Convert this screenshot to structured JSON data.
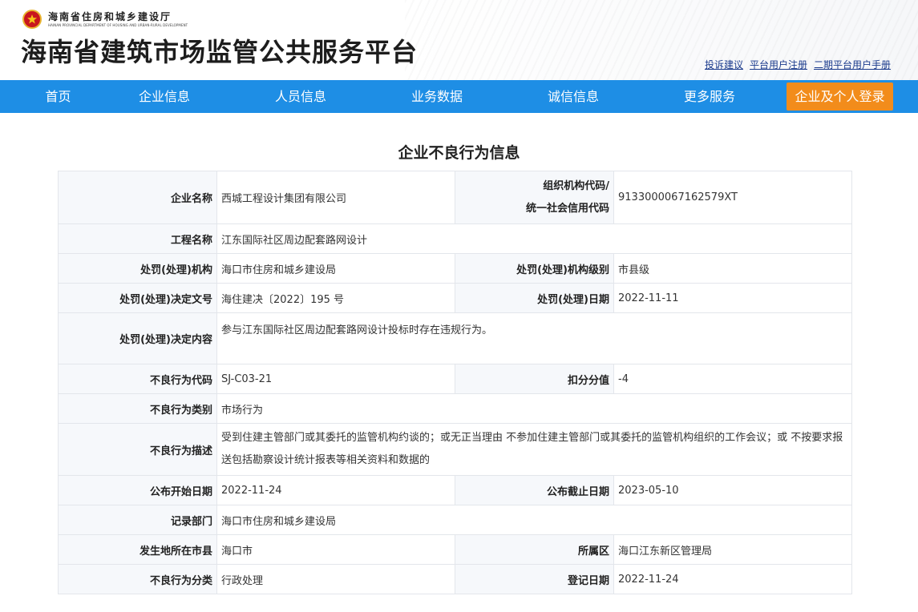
{
  "header": {
    "dept_name_cn": "海南省住房和城乡建设厅",
    "dept_name_en": "HAINAN PROVINCIAL DEPARTMENT OF HOUSING AND URBAN-RURAL DEVELOPMENT",
    "platform_title": "海南省建筑市场监管公共服务平台",
    "links": [
      "投诉建议",
      "平台用户注册",
      "二期平台用户手册"
    ]
  },
  "nav": {
    "items": [
      "首页",
      "企业信息",
      "人员信息",
      "业务数据",
      "诚信信息",
      "更多服务"
    ],
    "login": "企业及个人登录"
  },
  "page": {
    "title": "企业不良行为信息"
  },
  "record": {
    "company_name_label": "企业名称",
    "company_name": "西城工程设计集团有限公司",
    "org_code_label_1": "组织机构代码/",
    "org_code_label_2": "统一社会信用代码",
    "org_code": "9133000067162579XT",
    "project_name_label": "工程名称",
    "project_name": "江东国际社区周边配套路网设计",
    "agency_label": "处罚(处理)机构",
    "agency": "海口市住房和城乡建设局",
    "agency_level_label": "处罚(处理)机构级别",
    "agency_level": "市县级",
    "decision_no_label": "处罚(处理)决定文号",
    "decision_no": "海住建决〔2022〕195 号",
    "decision_date_label": "处罚(处理)日期",
    "decision_date": "2022-11-11",
    "decision_content_label": "处罚(处理)决定内容",
    "decision_content": "参与江东国际社区周边配套路网设计投标时存在违规行为。",
    "behavior_code_label": "不良行为代码",
    "behavior_code": "SJ-C03-21",
    "deduct_label": "扣分分值",
    "deduct": "-4",
    "behavior_type_label": "不良行为类别",
    "behavior_type": "市场行为",
    "behavior_desc_label": "不良行为描述",
    "behavior_desc": "受到住建主管部门或其委托的监管机构约谈的；或无正当理由 不参加住建主管部门或其委托的监管机构组织的工作会议；或 不按要求报送包括勘察设计统计报表等相关资料和数据的",
    "publish_start_label": "公布开始日期",
    "publish_start": "2022-11-24",
    "publish_end_label": "公布截止日期",
    "publish_end": "2023-05-10",
    "record_dept_label": "记录部门",
    "record_dept": "海口市住房和城乡建设局",
    "city_label": "发生地所在市县",
    "city": "海口市",
    "district_label": "所属区",
    "district": "海口江东新区管理局",
    "category_label": "不良行为分类",
    "category": "行政处理",
    "register_date_label": "登记日期",
    "register_date": "2022-11-24"
  },
  "colors": {
    "nav_bg": "#1e8ee5",
    "login_bg": "#f28c1b",
    "link": "#1a3a8c"
  }
}
